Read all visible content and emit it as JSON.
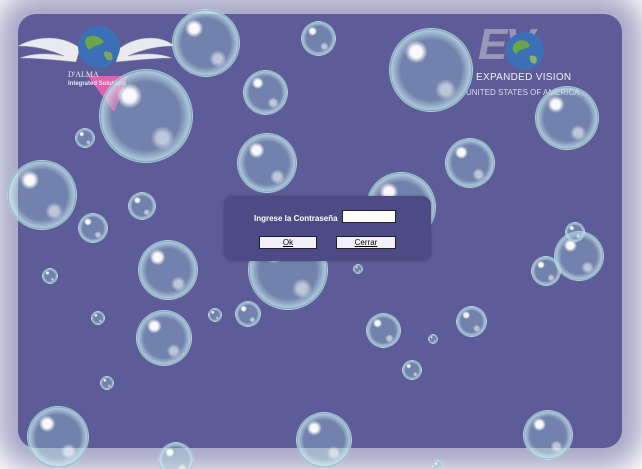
{
  "brand_left": {
    "name": "D'ALMA",
    "tagline": "Integrated Solutions",
    "icon": "winged-globe-icon"
  },
  "brand_right": {
    "monogram": "EV",
    "name": "EXPANDED VISION",
    "country": "UNITED STATES OF AMERICA",
    "icon": "globe-icon"
  },
  "dialog": {
    "password_label": "Ingrese la Contraseña",
    "password_value": "",
    "ok_label": "Ok",
    "cancel_label": "Cerrar"
  },
  "colors": {
    "background": "#5e5c98",
    "dialog": "#4d4b86",
    "button": "#f3eef9",
    "accent_pink": "#e35fb0"
  }
}
